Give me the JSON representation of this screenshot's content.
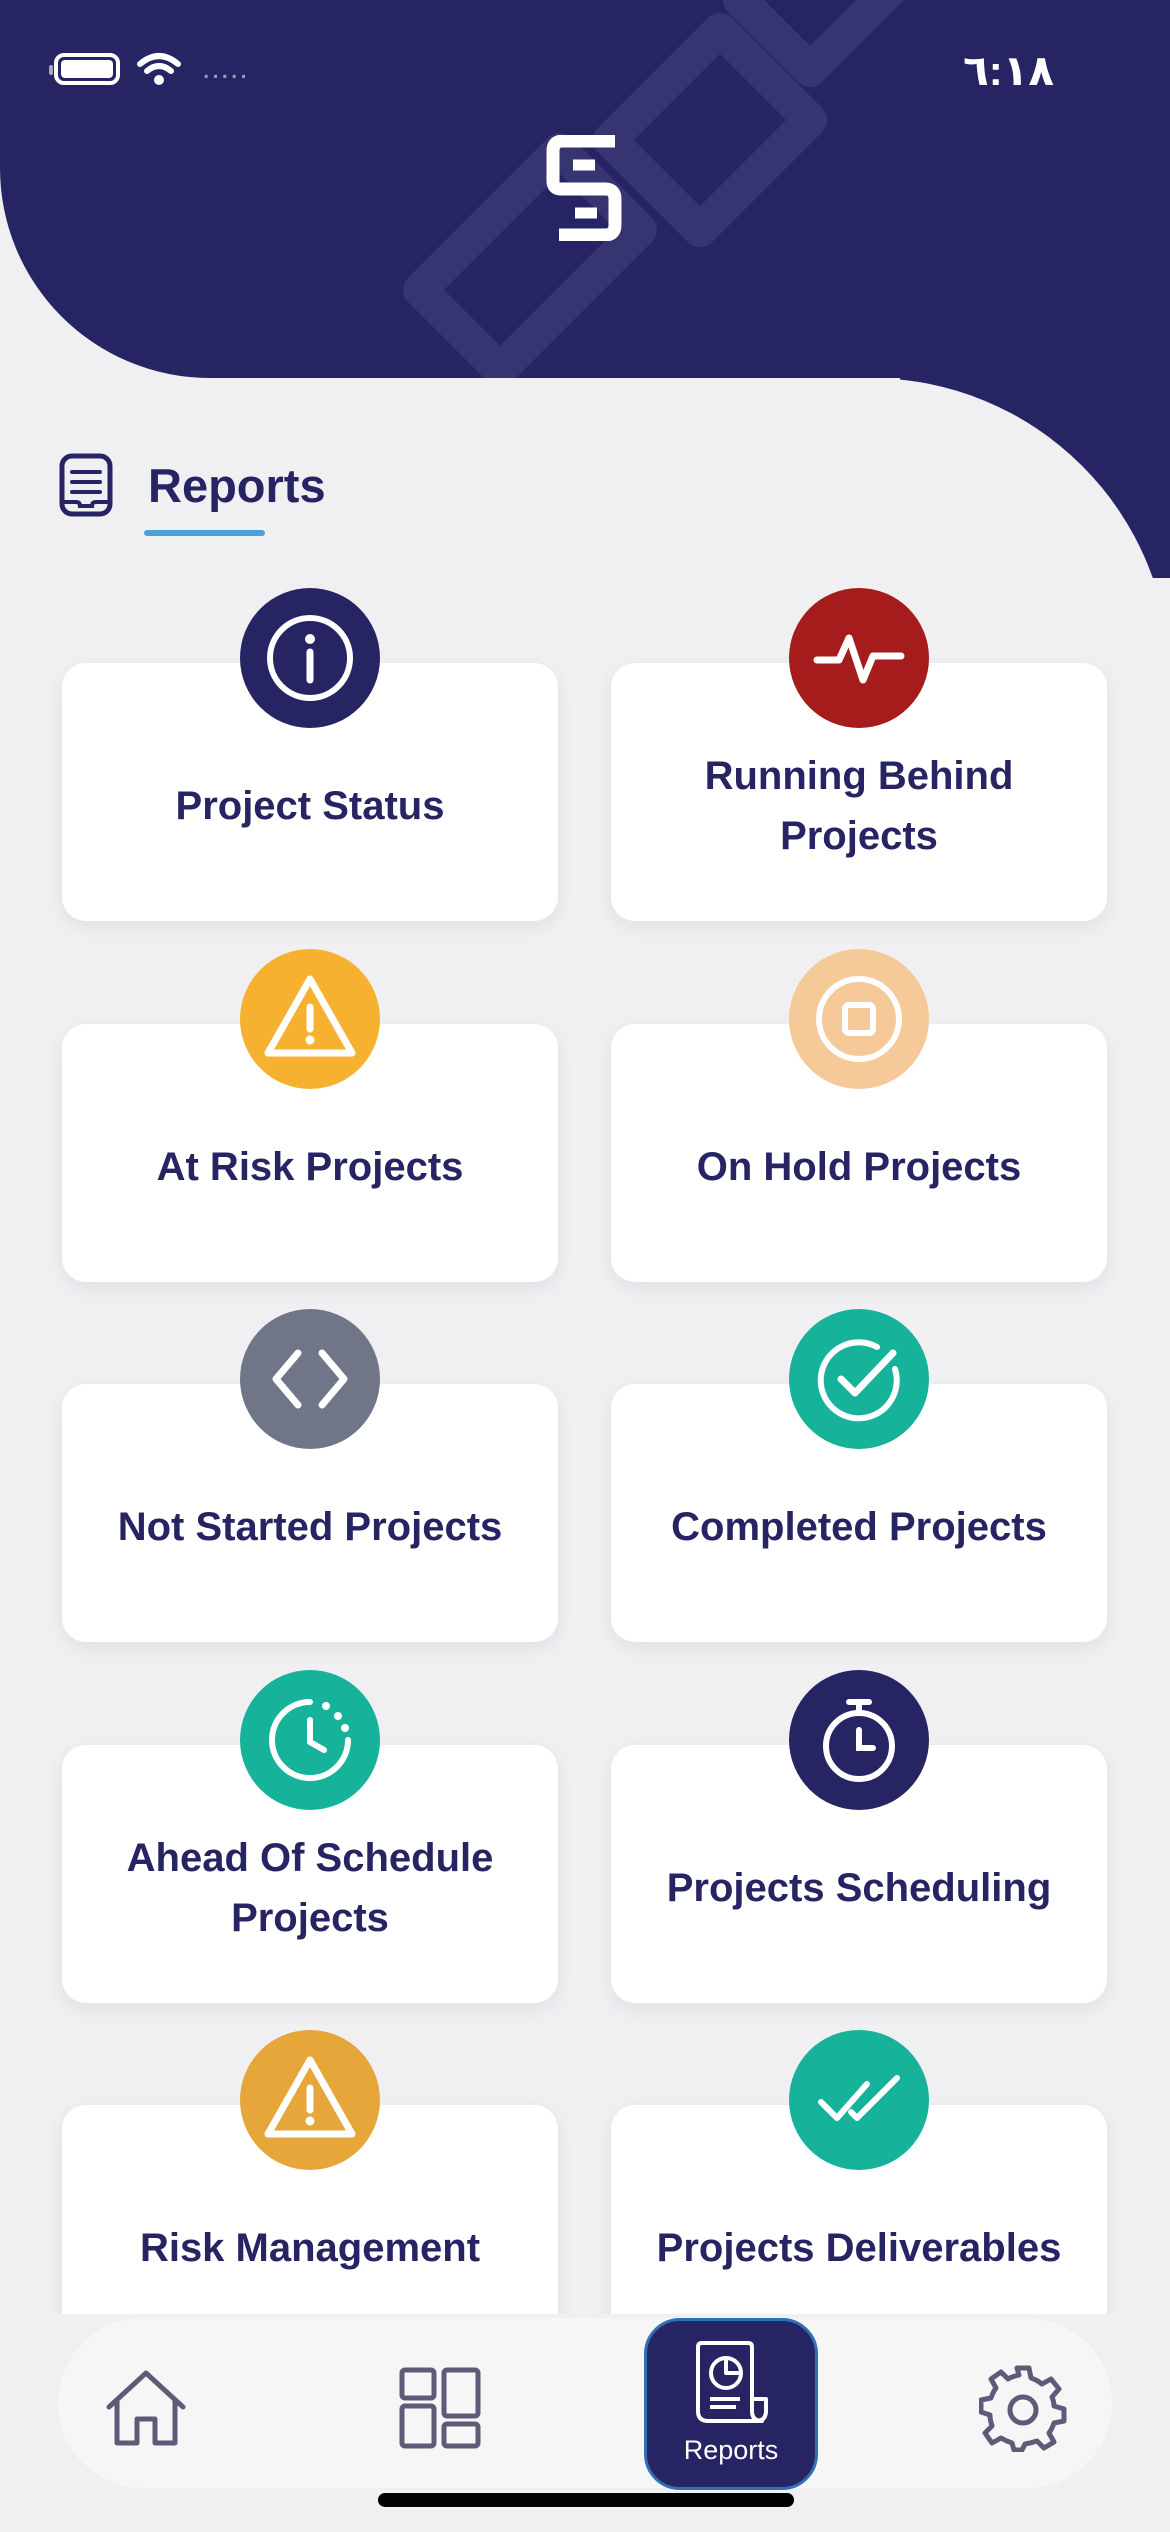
{
  "status_bar": {
    "time": "٦:١٨",
    "signal": "....."
  },
  "section": {
    "title": "Reports",
    "icon": "report-document-icon"
  },
  "cards": [
    {
      "label": "Project Status",
      "icon": "info-icon",
      "color": "#272463"
    },
    {
      "label": "Running Behind Projects",
      "icon": "pulse-icon",
      "color": "#a61b1b"
    },
    {
      "label": "At Risk Projects",
      "icon": "warning-icon",
      "color": "#f7b130"
    },
    {
      "label": "On Hold Projects",
      "icon": "stop-icon",
      "color": "#f6c998"
    },
    {
      "label": "Not Started Projects",
      "icon": "code-brackets-icon",
      "color": "#707687"
    },
    {
      "label": "Completed Projects",
      "icon": "check-circle-icon",
      "color": "#16b29a"
    },
    {
      "label": "Ahead Of Schedule Projects",
      "icon": "clock-icon",
      "color": "#16b29a"
    },
    {
      "label": "Projects Scheduling",
      "icon": "stopwatch-icon",
      "color": "#272463"
    },
    {
      "label": "Risk Management",
      "icon": "warning-icon",
      "color": "#e6a63a"
    },
    {
      "label": "Projects Deliverables",
      "icon": "double-check-icon",
      "color": "#16b29a"
    }
  ],
  "nav": {
    "home": "home-icon",
    "dashboard": "dashboard-icon",
    "reports_label": "Reports",
    "settings": "gear-icon"
  },
  "colors": {
    "primary": "#272463",
    "background": "#f0f0f2",
    "accent": "#4aa3d6"
  }
}
